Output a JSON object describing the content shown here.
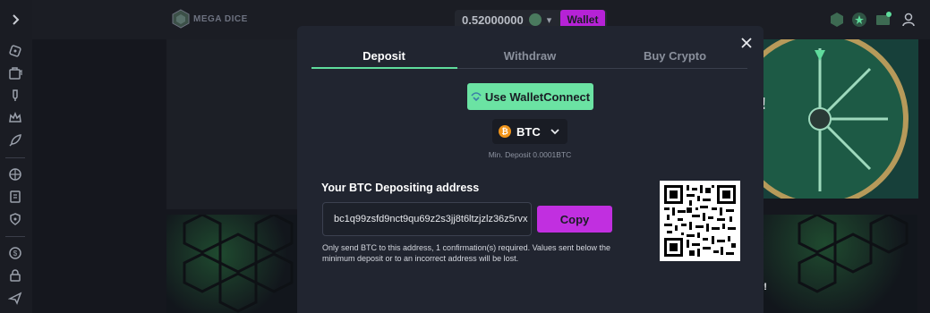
{
  "header": {
    "logo_text": "MEGA DICE",
    "balance": "0.52000000",
    "wallet_label": "Wallet"
  },
  "modal": {
    "tabs": [
      {
        "label": "Deposit",
        "active": true
      },
      {
        "label": "Withdraw",
        "active": false
      },
      {
        "label": "Buy Crypto",
        "active": false
      }
    ],
    "walletconnect_label": "Use WalletConnect",
    "coin": {
      "label": "BTC",
      "icon": "bitcoin-icon"
    },
    "min_deposit": "Min. Deposit 0.0001BTC",
    "address_title": "Your BTC Depositing address",
    "address": "bc1q99zsfd9nct9qu69z2s3jj8t6ltzjzlz36z5rvx",
    "copy_label": "Copy",
    "warning": "Only send BTC to this address, 1 confirmation(s) required. Values sent below the minimum deposit or to an incorrect address will be lost."
  },
  "background": {
    "partial_text_1": "!",
    "partial_text_2": "r!"
  },
  "colors": {
    "accent_green": "#6be3a3",
    "accent_purple": "#c12fe0",
    "modal_bg": "#212530",
    "page_bg": "#15171e"
  },
  "sidebar_icons": [
    "chevron-right-icon",
    "casino-chip-icon",
    "slots-icon",
    "cocktail-icon",
    "crown-icon",
    "rocket-icon",
    "basketball-icon",
    "blog-icon",
    "shield-icon",
    "dollar-icon",
    "lock-icon",
    "plane-icon"
  ]
}
